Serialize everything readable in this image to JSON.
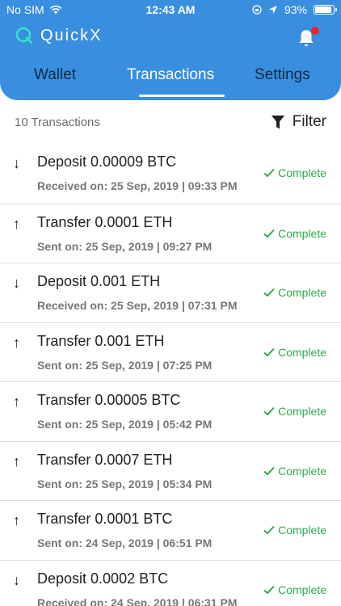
{
  "status_bar": {
    "carrier": "No SIM",
    "time": "12:43 AM",
    "battery": "93%",
    "battery_level": 0.93
  },
  "header": {
    "brand": "QuickX",
    "tabs": [
      {
        "label": "Wallet",
        "active": false
      },
      {
        "label": "Transactions",
        "active": true
      },
      {
        "label": "Settings",
        "active": false
      }
    ]
  },
  "list_header": {
    "count": "10 Transactions",
    "filter_label": "Filter"
  },
  "transactions": [
    {
      "direction": "down",
      "arrow": "↓",
      "title": "Deposit 0.00009 BTC",
      "date_label": "Received on:",
      "date": "25 Sep, 2019 | 09:33 PM",
      "status": "Complete"
    },
    {
      "direction": "up",
      "arrow": "↑",
      "title": "Transfer 0.0001 ETH",
      "date_label": "Sent on:",
      "date": "25 Sep, 2019 | 09:27 PM",
      "status": "Complete"
    },
    {
      "direction": "down",
      "arrow": "↓",
      "title": "Deposit 0.001 ETH",
      "date_label": "Received on:",
      "date": "25 Sep, 2019 | 07:31 PM",
      "status": "Complete"
    },
    {
      "direction": "up",
      "arrow": "↑",
      "title": "Transfer 0.001 ETH",
      "date_label": "Sent on:",
      "date": "25 Sep, 2019 | 07:25 PM",
      "status": "Complete"
    },
    {
      "direction": "up",
      "arrow": "↑",
      "title": "Transfer 0.00005 BTC",
      "date_label": "Sent on:",
      "date": "25 Sep, 2019 | 05:42 PM",
      "status": "Complete"
    },
    {
      "direction": "up",
      "arrow": "↑",
      "title": "Transfer 0.0007 ETH",
      "date_label": "Sent on:",
      "date": "25 Sep, 2019 | 05:34 PM",
      "status": "Complete"
    },
    {
      "direction": "up",
      "arrow": "↑",
      "title": "Transfer 0.0001 BTC",
      "date_label": "Sent on:",
      "date": "24 Sep, 2019 | 06:51 PM",
      "status": "Complete"
    },
    {
      "direction": "down",
      "arrow": "↓",
      "title": "Deposit 0.0002 BTC",
      "date_label": "Received on:",
      "date": "24 Sep, 2019 | 06:31 PM",
      "status": "Complete"
    }
  ],
  "colors": {
    "header": "#3a8ee0",
    "complete": "#2fa84f",
    "notification": "#e4262c"
  }
}
